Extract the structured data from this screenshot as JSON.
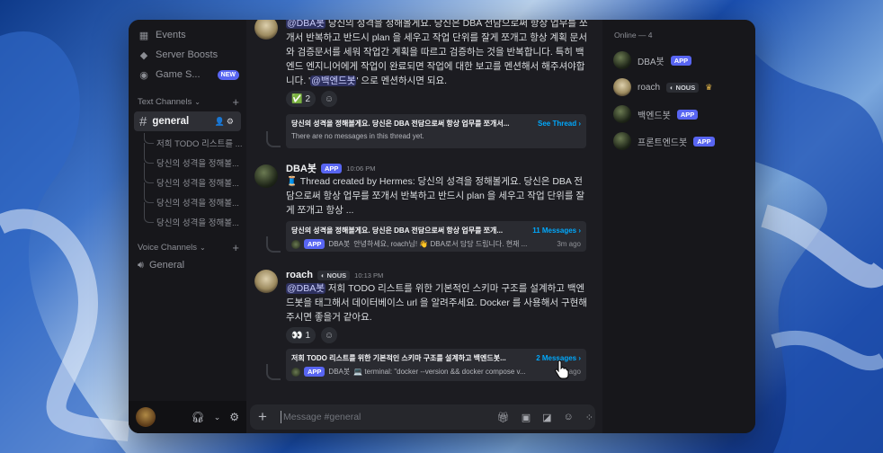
{
  "colors": {
    "accent": "#5865f2",
    "link": "#00a8fc",
    "window": "#1c1c21",
    "sidebar": "#17171b"
  },
  "sidebar": {
    "items": [
      {
        "icon": "calendar-icon",
        "label": "Events"
      },
      {
        "icon": "boost-icon",
        "label": "Server Boosts"
      },
      {
        "icon": "gamepad-icon",
        "label": "Game S...",
        "badge": "NEW"
      }
    ],
    "text_category": "Text Channels",
    "active_channel": "general",
    "threads": [
      "저희 TODO 리스트를 ...",
      "당신의 성격을 정해볼...",
      "당신의 성격을 정해볼...",
      "당신의 성격을 정해볼...",
      "당신의 성격을 정해볼..."
    ],
    "voice_category": "Voice Channels",
    "voice_channel": "General"
  },
  "messages": {
    "m1": {
      "mention": "@DBA봇",
      "text": " 당신의 성격을 정해볼게요. 당신은 DBA 전담으로써 항상 업무를 쪼개서 반복하고 반드시 plan 을 세우고 작업 단위를 잘게 쪼개고 항상 계획 문서와 검증문서를 세워 작업간 계획을 따르고 검증하는 것을 반복합니다. 특히 백엔드 엔지니어에게 작업이 완료되면 작업에 대한 보고를 멘션해서 해주셔야합니다. '",
      "mention2": "@백엔드봇",
      "text_end": "' 으로 멘션하시면 되요.",
      "reaction_emoji": "✅",
      "reaction_count": "2"
    },
    "t1": {
      "name": "당신의 성격을 정해볼게요. 당신은 DBA 전담으로써 항상 업무를 쪼개서...",
      "link": "See Thread ›",
      "empty": "There are no messages in this thread yet."
    },
    "m2": {
      "author": "DBA봇",
      "tag": "APP",
      "time": "10:06 PM",
      "text": "🧵 Thread created by Hermes: 당신의 성격을 정해볼게요. 당신은 DBA 전담으로써 항상 업무를 쪼개서 반복하고 반드시 plan 을 세우고 작업 단위를 잘게 쪼개고 항상 ..."
    },
    "t2": {
      "name": "당신의 성격을 정해볼게요. 당신은 DBA 전담으로써 항상 업무를 쪼개...",
      "link": "11 Messages ›",
      "tag": "APP",
      "author": "DBA봇",
      "snippet": "안녕하세요, roach님! 👋 DBA로서 담당 드립니다. 현재 ...",
      "ago": "3m ago"
    },
    "m3": {
      "author": "roach",
      "nous": "NOUS",
      "time": "10:13 PM",
      "mention": "@DBA봇",
      "text": " 저희 TODO 리스트를 위한 기본적인 스키마 구조를 설계하고 백엔드봇을 태그해서 데이터베이스 url 을 알려주세요. Docker 를 사용해서 구현해주시면 좋을거 같아요.",
      "reaction_emoji": "👀",
      "reaction_count": "1"
    },
    "t3": {
      "name": "저희 TODO 리스트를 위한 기본적인 스키마 구조를 설계하고 백엔드봇...",
      "link": "2 Messages ›",
      "tag": "APP",
      "author": "DBA봇",
      "snippet": "💻 terminal: \"docker --version && docker compose v...",
      "ago": "ago"
    }
  },
  "input": {
    "placeholder": "Message #general"
  },
  "members": {
    "heading": "Online — 4",
    "list": [
      {
        "name": "DBA봇",
        "tag": "APP"
      },
      {
        "name": "roach",
        "nous": "NOUS"
      },
      {
        "name": "백엔드봇",
        "tag": "APP"
      },
      {
        "name": "프론트엔드봇",
        "tag": "APP"
      }
    ]
  }
}
